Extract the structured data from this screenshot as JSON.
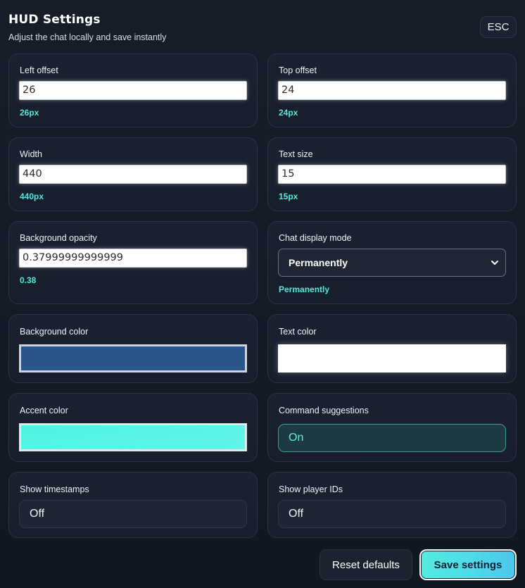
{
  "header": {
    "title": "HUD Settings",
    "subtitle": "Adjust the chat locally and save instantly",
    "esc_label": "ESC"
  },
  "fields": {
    "left_offset": {
      "label": "Left offset",
      "value": "26",
      "hint": "26px"
    },
    "top_offset": {
      "label": "Top offset",
      "value": "24",
      "hint": "24px"
    },
    "width": {
      "label": "Width",
      "value": "440",
      "hint": "440px"
    },
    "text_size": {
      "label": "Text size",
      "value": "15",
      "hint": "15px"
    },
    "bg_opacity": {
      "label": "Background opacity",
      "value": "0.37999999999999",
      "hint": "0.38"
    },
    "chat_display_mode": {
      "label": "Chat display mode",
      "selected": "Permanently",
      "hint": "Permanently"
    },
    "bg_color": {
      "label": "Background color",
      "color": "#29558c"
    },
    "text_color": {
      "label": "Text color",
      "color": "#ffffff"
    },
    "accent_color": {
      "label": "Accent color",
      "color": "#55f2e4"
    },
    "command_suggestions": {
      "label": "Command suggestions",
      "state": "On"
    },
    "show_timestamps": {
      "label": "Show timestamps",
      "state": "Off"
    },
    "show_player_ids": {
      "label": "Show player IDs",
      "state": "Off"
    }
  },
  "actions": {
    "reset_label": "Reset defaults",
    "save_label": "Save settings"
  },
  "colors": {
    "accent": "#54e9dc",
    "background": "#131a25"
  }
}
